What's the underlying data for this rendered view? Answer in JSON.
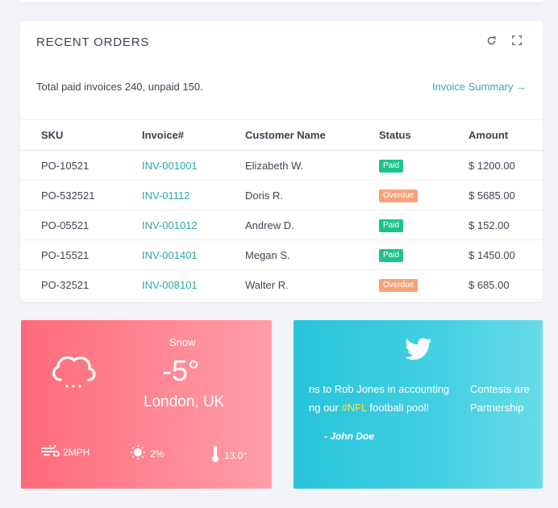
{
  "orders": {
    "title": "RECENT ORDERS",
    "summary": "Total paid invoices 240, unpaid 150.",
    "summary_link": "Invoice Summary →",
    "columns": [
      "SKU",
      "Invoice#",
      "Customer Name",
      "Status",
      "Amount"
    ],
    "rows": [
      {
        "sku": "PO-10521",
        "invoice": "INV-001001",
        "customer": "Elizabeth W.",
        "status": "Paid",
        "amount": "$ 1200.00"
      },
      {
        "sku": "PO-532521",
        "invoice": "INV-01112",
        "customer": "Doris R.",
        "status": "Overdue",
        "amount": "$ 5685.00"
      },
      {
        "sku": "PO-05521",
        "invoice": "INV-001012",
        "customer": "Andrew D.",
        "status": "Paid",
        "amount": "$ 152.00"
      },
      {
        "sku": "PO-15521",
        "invoice": "INV-001401",
        "customer": "Megan S.",
        "status": "Paid",
        "amount": "$ 1450.00"
      },
      {
        "sku": "PO-32521",
        "invoice": "INV-008101",
        "customer": "Walter R.",
        "status": "Overdue",
        "amount": "$ 685.00"
      }
    ],
    "status_colors": {
      "Paid": "#1ec28b",
      "Overdue": "#f9a27a"
    }
  },
  "weather": {
    "condition": "Snow",
    "temperature": "-5°",
    "city": "London, UK",
    "wind": "2MPH",
    "precipitation": "2%",
    "thermo": "13.0°"
  },
  "twitter": {
    "line1a": "ns to Rob Jones in accounting",
    "line2a_pre": "ng our ",
    "hashtag": "#NFL",
    "line2a_post": " football pool!",
    "line1b": "Contests are",
    "line2b": "Partnership",
    "author": "- John Doe"
  },
  "colors": {
    "accent": "#3ca3b8",
    "invoice_link": "#2aa8a8",
    "weather_bg": "#ff6a7a",
    "twitter_bg": "#27c3db"
  }
}
